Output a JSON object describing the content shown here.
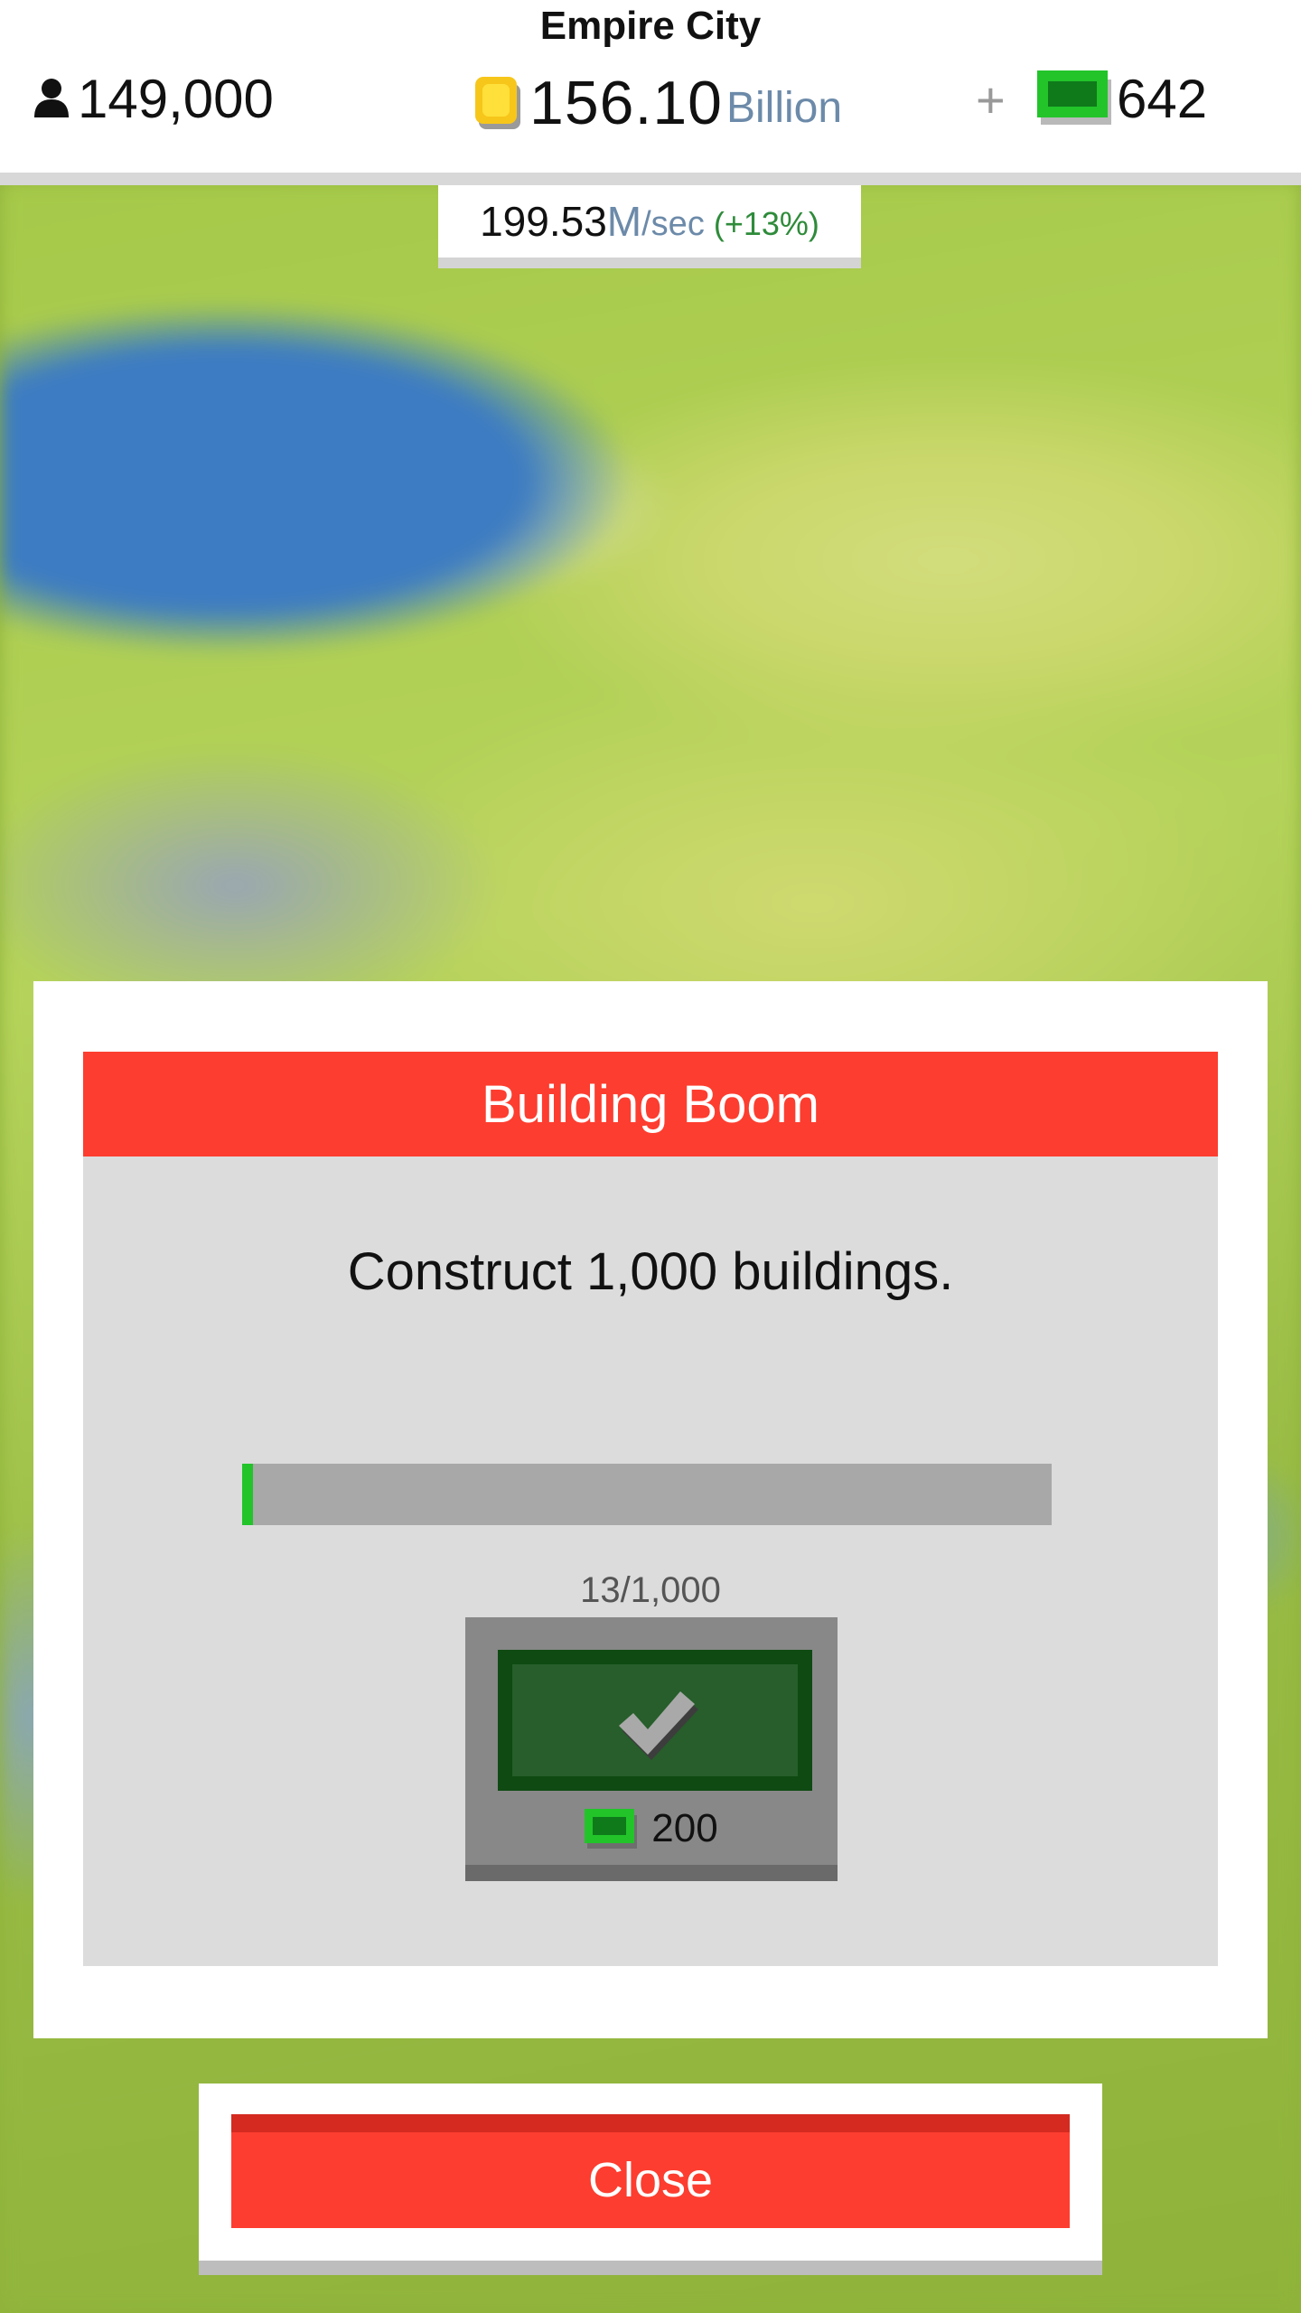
{
  "header": {
    "city_name": "Empire City",
    "population": "149,000",
    "money_value": "156.10",
    "money_unit": "Billion",
    "plus_label": "+",
    "cash": "642",
    "rate_value": "199.53",
    "rate_unit": "M",
    "rate_per": "/sec",
    "rate_bonus": "(+13%)"
  },
  "dialog": {
    "title": "Building Boom",
    "description": "Construct 1,000 buildings.",
    "progress_current": 13,
    "progress_total": 1000,
    "progress_fraction": 0.013,
    "progress_text": "13/1,000",
    "reward_amount": "200",
    "claim_icon": "checkmark-icon"
  },
  "footer": {
    "close_label": "Close"
  },
  "colors": {
    "accent_red": "#fd3d2f",
    "cash_green": "#22c42a",
    "claim_dark_green": "#0e4a12",
    "coin_yellow": "#f7c61a",
    "unit_blue": "#6c8aa9",
    "bonus_green": "#2e8b3a"
  }
}
